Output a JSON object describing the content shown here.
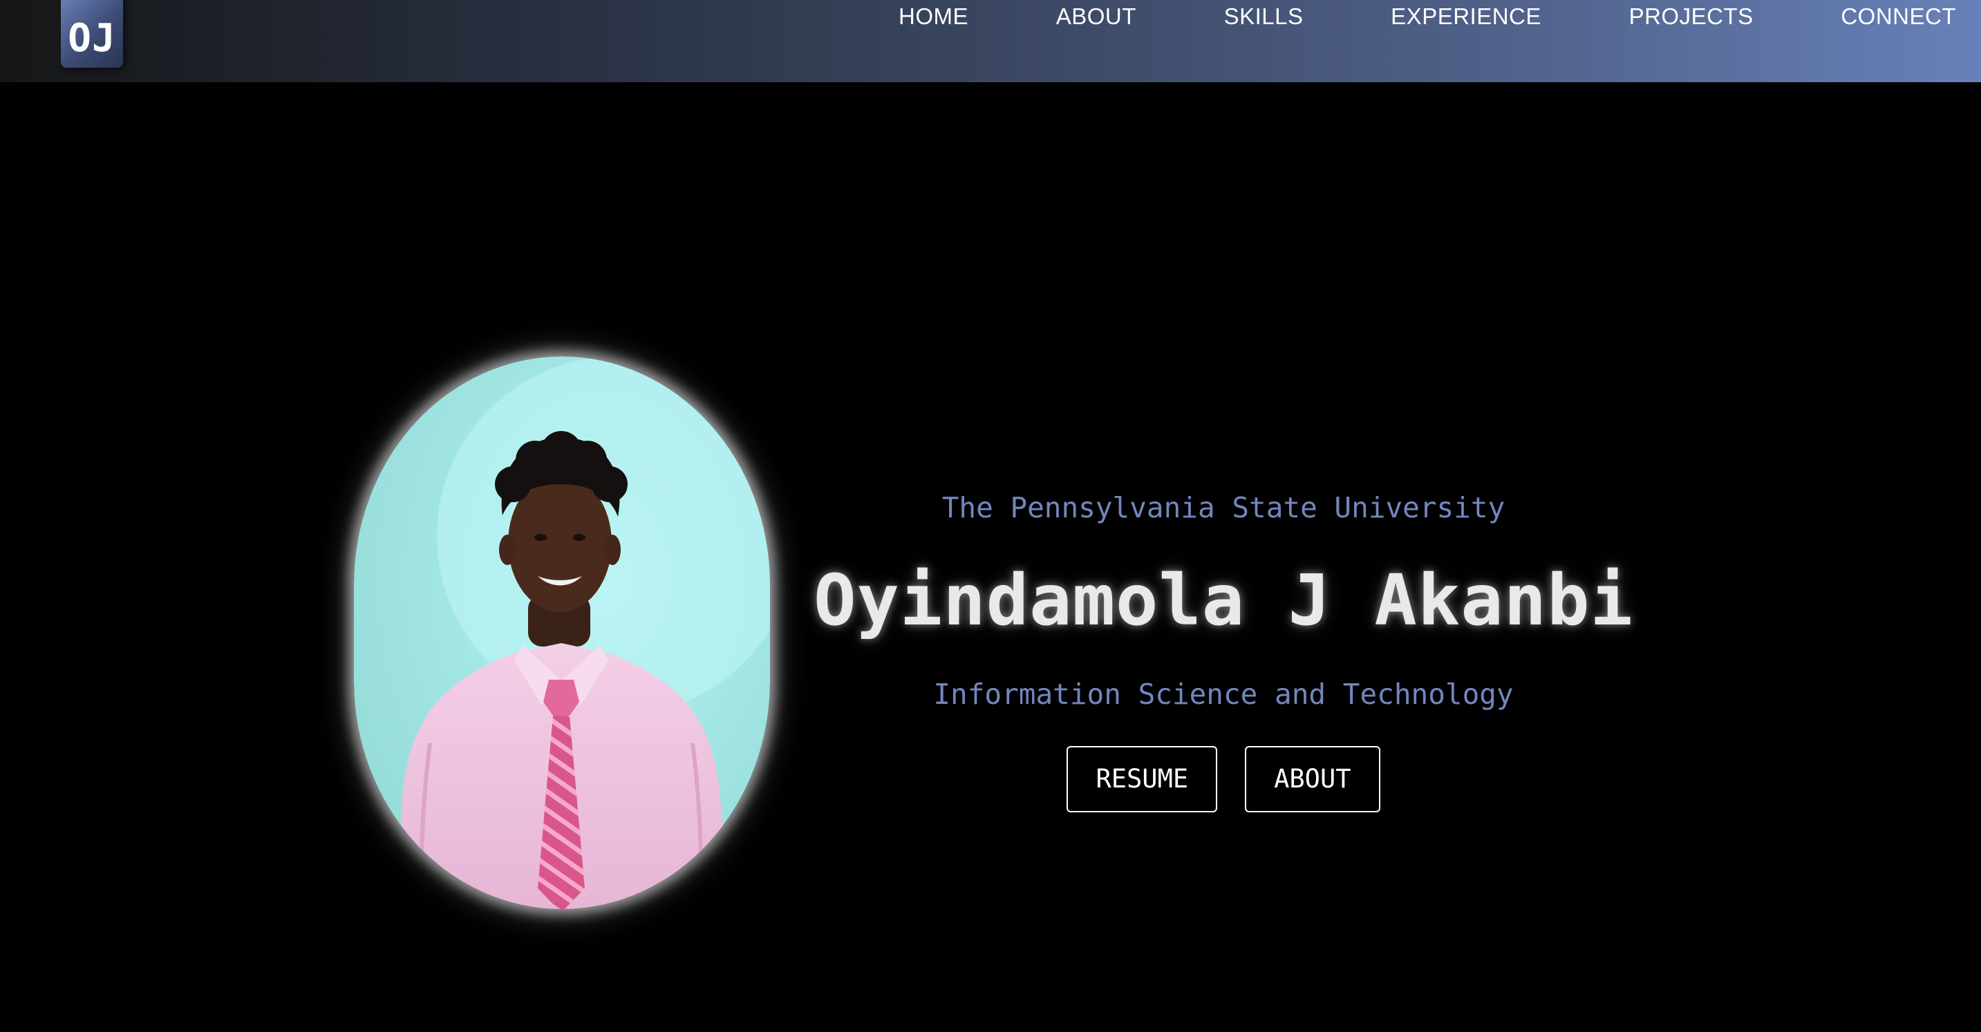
{
  "brand": {
    "logo_text": "OJ"
  },
  "nav": {
    "items": [
      {
        "label": "HOME"
      },
      {
        "label": "ABOUT"
      },
      {
        "label": "SKILLS"
      },
      {
        "label": "EXPERIENCE"
      },
      {
        "label": "PROJECTS"
      },
      {
        "label": "CONNECT"
      }
    ]
  },
  "hero": {
    "university": "The Pennsylvania State University",
    "name": "Oyindamola J Akanbi",
    "major": "Information Science and Technology",
    "buttons": {
      "resume": "RESUME",
      "about": "ABOUT"
    }
  },
  "colors": {
    "background": "#000000",
    "accent_text": "#7386bd",
    "nav_gradient_start": "#151617",
    "nav_gradient_end": "#6781b8"
  }
}
